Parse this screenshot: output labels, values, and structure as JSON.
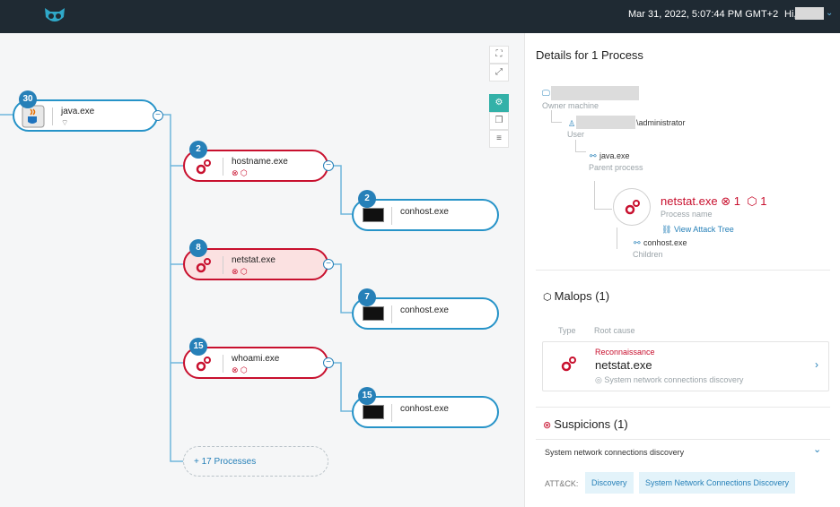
{
  "header": {
    "datetime": "Mar 31, 2022, 5:07:44 PM GMT+2",
    "greeting": "Hi,",
    "logo_icon": "owl-logo-icon"
  },
  "graph": {
    "root": {
      "name": "java.exe",
      "count": "30",
      "icon": "java-cup-icon"
    },
    "children": [
      {
        "name": "hostname.exe",
        "count": "2",
        "child": {
          "name": "conhost.exe",
          "count": "2"
        }
      },
      {
        "name": "netstat.exe",
        "count": "8",
        "child": {
          "name": "conhost.exe",
          "count": "7"
        }
      },
      {
        "name": "whoami.exe",
        "count": "15",
        "child": {
          "name": "conhost.exe",
          "count": "15"
        }
      }
    ],
    "more_label": "+ 17 Processes",
    "tools": [
      "focus-icon",
      "expand-icon",
      "settings-icon",
      "layers-icon",
      "list-icon"
    ]
  },
  "details": {
    "title": "Details for 1 Process",
    "owner_machine_label": "Owner machine",
    "user_suffix": "\\administrator",
    "user_label": "User",
    "parent_value": "java.exe",
    "parent_label": "Parent process",
    "process_name": "netstat.exe",
    "process_count_a": "1",
    "process_count_b": "1",
    "process_name_label": "Process name",
    "view_attack_tree": "View Attack Tree",
    "children_value": "conhost.exe",
    "children_label": "Children"
  },
  "malops": {
    "title": "Malops (1)",
    "col_type": "Type",
    "col_root": "Root cause",
    "category": "Reconnaissance",
    "root_cause": "netstat.exe",
    "description": "System network connections discovery"
  },
  "suspicions": {
    "title": "Suspicions (1)",
    "item": "System network connections discovery",
    "attack_label": "ATT&CK:",
    "tags": [
      "Discovery",
      "System Network Connections Discovery"
    ]
  }
}
